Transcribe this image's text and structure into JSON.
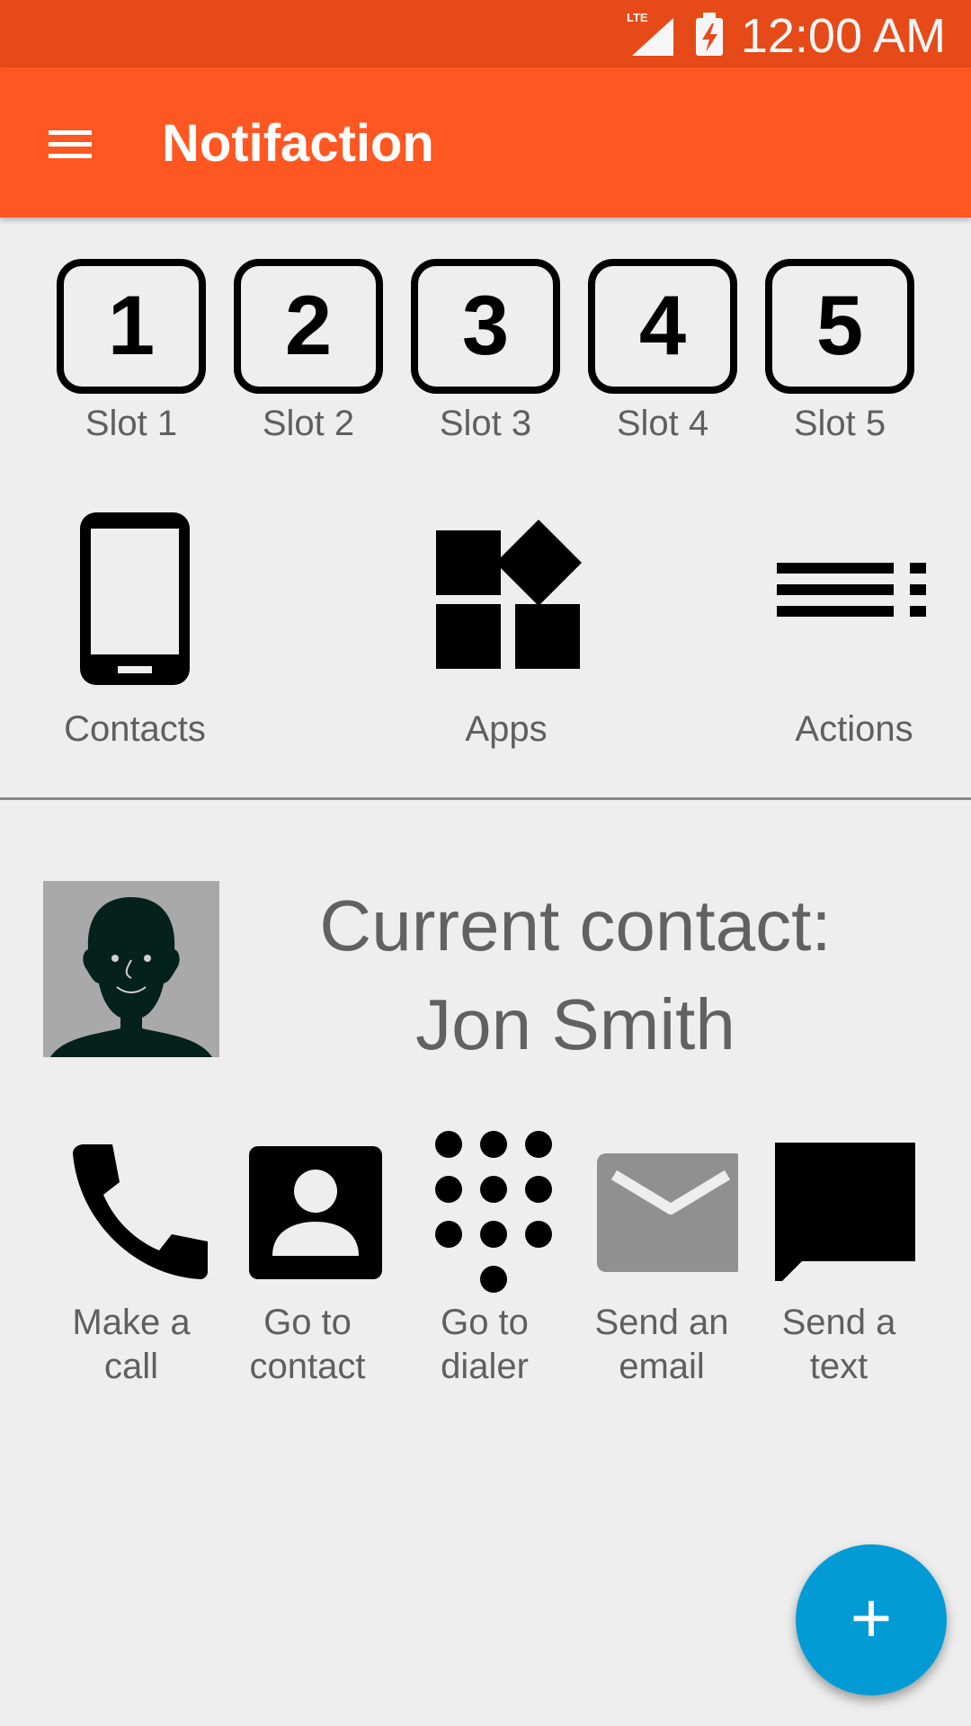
{
  "status_bar": {
    "network": "LTE",
    "time": "12:00 AM"
  },
  "app_bar": {
    "title": "Notifaction",
    "menu_icon": "hamburger-menu-icon"
  },
  "slots": [
    {
      "number": "1",
      "label": "Slot 1"
    },
    {
      "number": "2",
      "label": "Slot 2"
    },
    {
      "number": "3",
      "label": "Slot 3"
    },
    {
      "number": "4",
      "label": "Slot 4"
    },
    {
      "number": "5",
      "label": "Slot 5"
    }
  ],
  "categories": [
    {
      "label": "Contacts",
      "icon": "smartphone-icon"
    },
    {
      "label": "Apps",
      "icon": "widgets-icon"
    },
    {
      "label": "Actions",
      "icon": "playlist-icon"
    }
  ],
  "contact": {
    "heading_line1": "Current contact:",
    "heading_line2": "Jon Smith",
    "avatar_icon": "person-silhouette-icon"
  },
  "actions": [
    {
      "line1": "Make a",
      "line2": "call",
      "icon": "phone-icon"
    },
    {
      "line1": "Go to",
      "line2": "contact",
      "icon": "contact-card-icon"
    },
    {
      "line1": "Go to",
      "line2": "dialer",
      "icon": "dialpad-icon"
    },
    {
      "line1": "Send an",
      "line2": "email",
      "icon": "email-icon"
    },
    {
      "line1": "Send a",
      "line2": "text",
      "icon": "message-icon"
    }
  ],
  "fab": {
    "label": "+",
    "icon": "add-icon"
  },
  "colors": {
    "status_bar": "#e64a19",
    "app_bar": "#ff5722",
    "background": "#eeeeee",
    "fab": "#039bd5",
    "label_text": "#5f5f5f"
  }
}
